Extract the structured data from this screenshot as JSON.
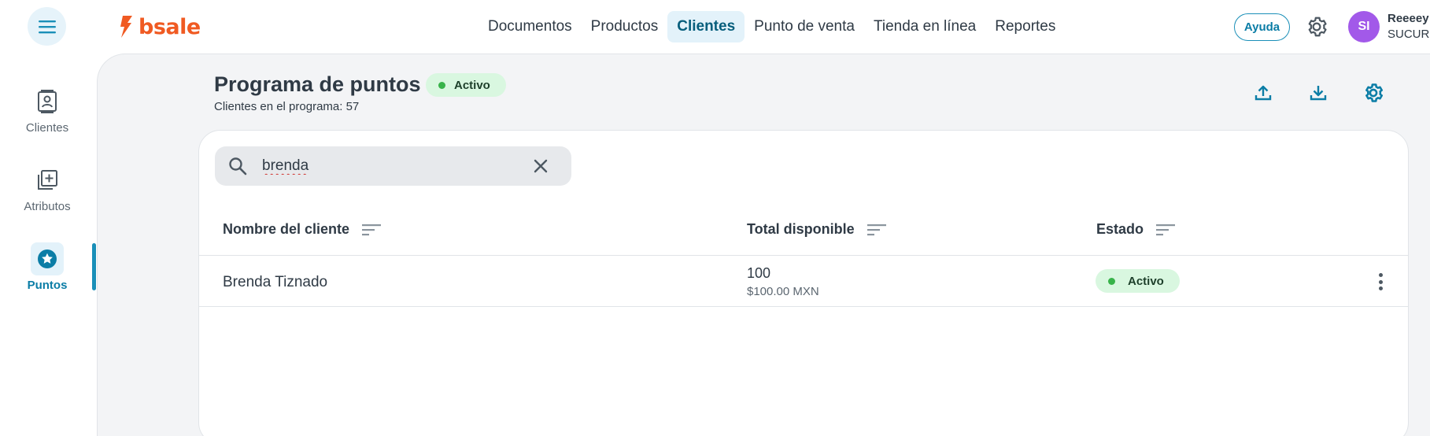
{
  "header": {
    "logo_text": "bsale",
    "nav": [
      {
        "label": "Documentos",
        "active": false
      },
      {
        "label": "Productos",
        "active": false
      },
      {
        "label": "Clientes",
        "active": true
      },
      {
        "label": "Punto de venta",
        "active": false
      },
      {
        "label": "Tienda en línea",
        "active": false
      },
      {
        "label": "Reportes",
        "active": false
      }
    ],
    "help_label": "Ayuda",
    "user_initials": "SI",
    "user_name": "Reeeey",
    "user_branch": "SUCURS"
  },
  "sidebar": {
    "items": [
      {
        "label": "Clientes",
        "icon": "contact-card-icon",
        "active": false
      },
      {
        "label": "Atributos",
        "icon": "add-box-icon",
        "active": false
      },
      {
        "label": "Puntos",
        "icon": "star-icon",
        "active": true
      }
    ]
  },
  "page": {
    "title": "Programa de puntos",
    "status": "Activo",
    "subtitle": "Clientes en el programa: 57"
  },
  "search": {
    "value": "brenda",
    "placeholder": ""
  },
  "table": {
    "columns": [
      "Nombre del cliente",
      "Total disponible",
      "Estado"
    ],
    "rows": [
      {
        "name": "Brenda Tiznado",
        "total": "100",
        "total_money": "$100.00 MXN",
        "status": "Activo"
      }
    ]
  },
  "colors": {
    "brand": "#f05a22",
    "accent": "#1a8fb8",
    "active_badge_bg": "#d9f7e0",
    "active_dot": "#38b34a",
    "avatar": "#a259e9"
  }
}
